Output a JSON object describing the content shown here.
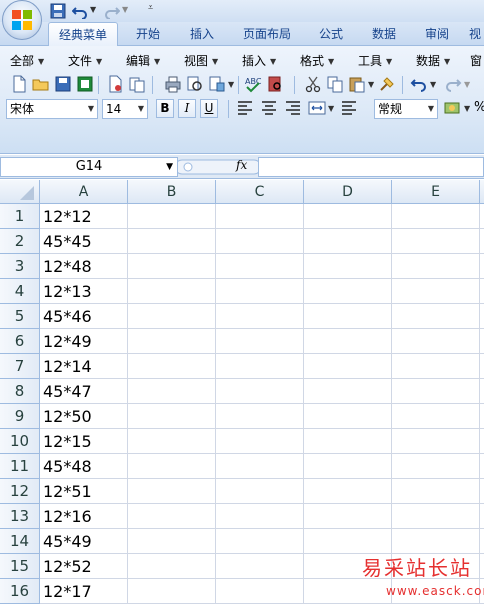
{
  "ribbon_tabs": [
    "经典菜单",
    "开始",
    "插入",
    "页面布局",
    "公式",
    "数据",
    "审阅",
    "视"
  ],
  "menus": [
    "全部",
    "文件",
    "编辑",
    "视图",
    "插入",
    "格式",
    "工具",
    "数据",
    "窗"
  ],
  "font": {
    "name": "宋体",
    "size": "14",
    "bold": "B",
    "italic": "I",
    "underline": "U",
    "number_format": "常规",
    "percent": "%"
  },
  "formula_bar": {
    "name_box": "G14",
    "fx": "fx",
    "content": ""
  },
  "columns": [
    "A",
    "B",
    "C",
    "D",
    "E"
  ],
  "rows": [
    {
      "num": "1",
      "a": "12*12"
    },
    {
      "num": "2",
      "a": "45*45"
    },
    {
      "num": "3",
      "a": "12*48"
    },
    {
      "num": "4",
      "a": "12*13"
    },
    {
      "num": "5",
      "a": "45*46"
    },
    {
      "num": "6",
      "a": "12*49"
    },
    {
      "num": "7",
      "a": "12*14"
    },
    {
      "num": "8",
      "a": "45*47"
    },
    {
      "num": "9",
      "a": "12*50"
    },
    {
      "num": "10",
      "a": "12*15"
    },
    {
      "num": "11",
      "a": "45*48"
    },
    {
      "num": "12",
      "a": "12*51"
    },
    {
      "num": "13",
      "a": "12*16"
    },
    {
      "num": "14",
      "a": "45*49"
    },
    {
      "num": "15",
      "a": "12*52"
    },
    {
      "num": "16",
      "a": "12*17"
    }
  ],
  "watermark": {
    "cn": "易采站长站",
    "en": "www.easck.com"
  },
  "colors": {
    "ribbon": "#dde9f7",
    "header": "#dde8f5",
    "gridline": "#d0d7e5",
    "accent": "#15428b",
    "watermark": "#e53030"
  }
}
